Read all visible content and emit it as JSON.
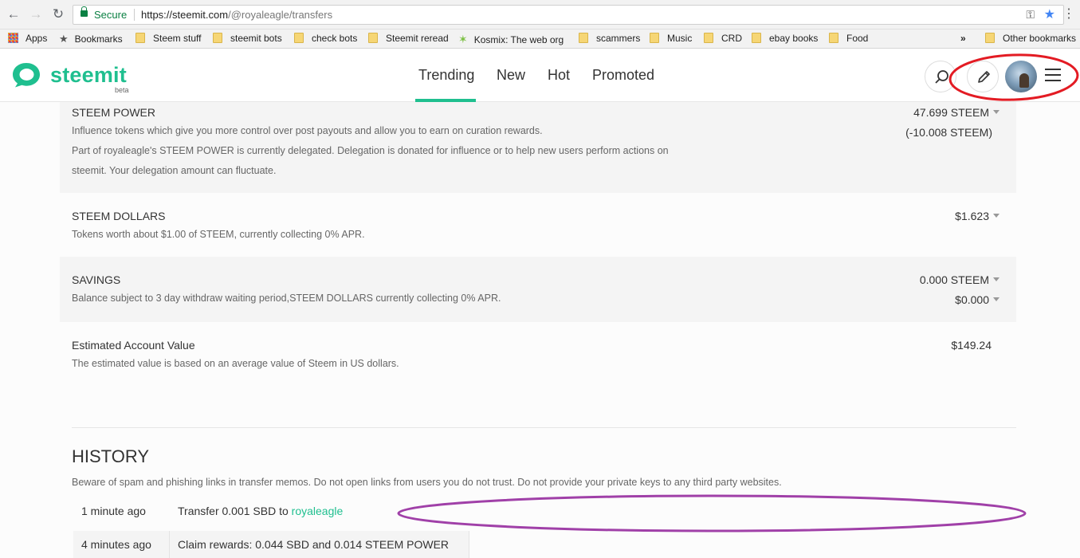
{
  "browser": {
    "secure_label": "Secure",
    "url_host": "https://steemit.com",
    "url_path": "/@royaleagle/transfers",
    "bookmarks": [
      {
        "label": "Apps",
        "icon": "apps-grid-icon"
      },
      {
        "label": "Bookmarks",
        "icon": "star-icon"
      },
      {
        "label": "Steem stuff",
        "icon": "folder-icon"
      },
      {
        "label": "steemit bots",
        "icon": "folder-icon"
      },
      {
        "label": "check bots",
        "icon": "folder-icon"
      },
      {
        "label": "Steemit reread",
        "icon": "folder-icon"
      },
      {
        "label": "Kosmix: The web org",
        "icon": "kosmix-star-icon"
      },
      {
        "label": "scammers",
        "icon": "folder-icon"
      },
      {
        "label": "Music",
        "icon": "folder-icon"
      },
      {
        "label": "CRD",
        "icon": "folder-icon"
      },
      {
        "label": "ebay books",
        "icon": "folder-icon"
      },
      {
        "label": "Food",
        "icon": "folder-icon"
      }
    ],
    "overflow_label": "»",
    "other_bookmarks": "Other bookmarks"
  },
  "header": {
    "logo_text": "steemit",
    "logo_badge": "beta",
    "nav": [
      "Trending",
      "New",
      "Hot",
      "Promoted"
    ],
    "active_nav": "Trending",
    "brand_color": "#1fbf8f"
  },
  "wallet": {
    "steem_power": {
      "title": "STEEM POWER",
      "desc1": "Influence tokens which give you more control over post payouts and allow you to earn on curation rewards.",
      "desc2": "Part of royaleagle's STEEM POWER is currently delegated. Delegation is donated for influence or to help new users perform actions on steemit. Your delegation amount can fluctuate.",
      "value": "47.699 STEEM",
      "delegated": "(-10.008 STEEM)"
    },
    "steem_dollars": {
      "title": "STEEM DOLLARS",
      "desc": "Tokens worth about $1.00 of STEEM, currently collecting 0% APR.",
      "value": "$1.623"
    },
    "savings": {
      "title": "SAVINGS",
      "desc": "Balance subject to 3 day withdraw waiting period,STEEM DOLLARS currently collecting 0% APR.",
      "steem": "0.000 STEEM",
      "sbd": "$0.000"
    },
    "estimated": {
      "title": "Estimated Account Value",
      "desc": "The estimated value is based on an average value of Steem in US dollars.",
      "value": "$149.24"
    }
  },
  "history": {
    "title": "HISTORY",
    "warning": "Beware of spam and phishing links in transfer memos. Do not open links from users you do not trust. Do not provide your private keys to any third party websites.",
    "rows": [
      {
        "time": "1 minute ago",
        "text": "Transfer 0.001 SBD to ",
        "link": "royaleagle"
      },
      {
        "time": "4 minutes ago",
        "text": "Claim rewards: 0.044 SBD and 0.014 STEEM POWER",
        "link": ""
      }
    ]
  }
}
